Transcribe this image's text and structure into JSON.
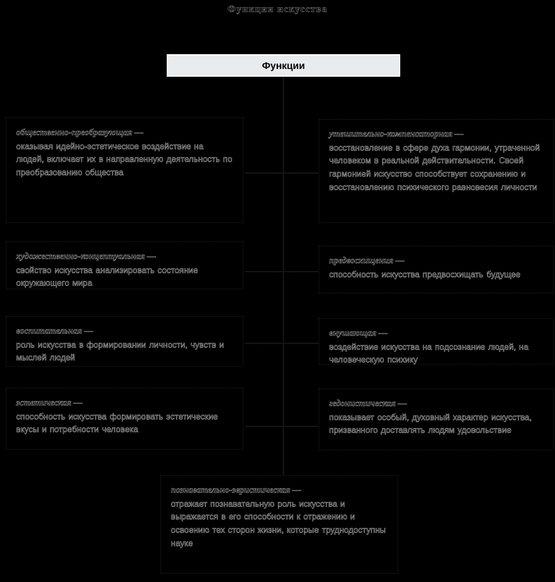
{
  "document": {
    "title": "Функции искусства",
    "root": {
      "label": "Функции",
      "fill_color": "#e8ecef",
      "border_color": "#ffffff"
    },
    "background_color": "#000000",
    "text_color": "#000000"
  },
  "nodes": {
    "left": [
      {
        "term": "общественно-преобразующая —",
        "description": "оказывая идейно-эстетическое воздействие на людей, включает их в направленную деятельность по преобразованию общества"
      },
      {
        "term": "художественно-концептуальная —",
        "description": "свойство искусства анализировать состояние окружающего мира"
      },
      {
        "term": "воспитательная —",
        "description": "роль искусства в формировании личности, чувств и мыслей людей"
      },
      {
        "term": "эстетическая —",
        "description": "способность искусства формировать эстетические вкусы и потребности человека"
      }
    ],
    "right": [
      {
        "term": "утешительно-компенсаторная —",
        "description": "восстановление в сфере духа гармонии, утраченной человеком в реальной действительности. Своей гармонией искусство способствует сохранению и восстановлению психического равновесия личности"
      },
      {
        "term": "предвосхищения —",
        "description": "способность искусства предвосхищать будущее"
      },
      {
        "term": "внушающая —",
        "description": "воздействие искусства на подсознание людей, на человеческую психику"
      },
      {
        "term": "гедонистическая —",
        "description": "показывает особый, духовный характер искусства, призванного доставлять людям удовольствие"
      }
    ],
    "bottom": {
      "term": "познавательно-эвристическая —",
      "description": "отражает познавательную роль искусства и выражается в его способности к отражению и освоению тех сторон жизни, которые труднодоступны науке"
    }
  }
}
